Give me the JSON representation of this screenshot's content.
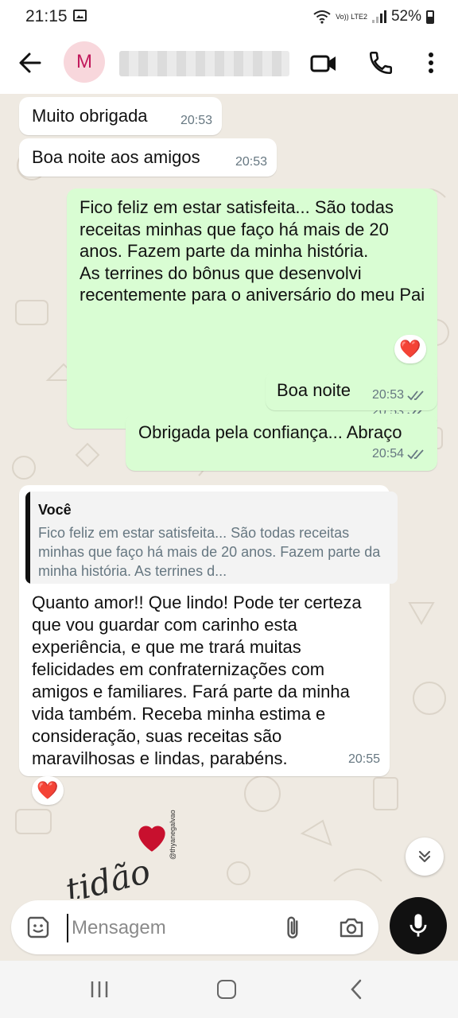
{
  "status_bar": {
    "time": "21:15",
    "network_label": "Vo)) LTE2",
    "battery_percent": "52%"
  },
  "header": {
    "avatar_letter": "M",
    "back_icon": "arrow-left-icon",
    "video_icon": "video-camera-icon",
    "call_icon": "phone-icon",
    "more_icon": "more-vertical-icon"
  },
  "messages": [
    {
      "direction": "in",
      "text": "Muito obrigada",
      "time": "20:53"
    },
    {
      "direction": "in",
      "text": "Boa noite aos amigos",
      "time": "20:53"
    },
    {
      "direction": "out",
      "text": "Fico feliz em estar satisfeita... São todas receitas minhas que faço há mais de 20 anos. Fazem parte da minha história.\nAs terrines do bônus que desenvolvi recentemente para o aniversário do meu Pai",
      "time": "20:53",
      "reaction": "❤️"
    },
    {
      "direction": "out",
      "text": "Boa noite",
      "time": "20:53"
    },
    {
      "direction": "out",
      "text": "Obrigada pela confiança... Abraço",
      "time": "20:54"
    },
    {
      "direction": "in",
      "quote_author": "Você",
      "quote_text": "Fico feliz em estar satisfeita... São todas receitas minhas que faço há mais de 20 anos. Fazem parte da minha história. As terrines d...",
      "text": "Quanto amor!! Que lindo! Pode ter certeza que vou guardar com carinho esta experiência, e que me trará muitas felicidades em confraternizações com amigos e familiares. Fará parte da minha vida também.  Receba minha estima e consideração,  suas receitas são maravilhosas e lindas, parabéns.",
      "time": "20:55",
      "reaction": "❤️"
    }
  ],
  "sticker": {
    "word": "tidão",
    "handle": "@thyanegalvao"
  },
  "composer": {
    "placeholder": "Mensagem",
    "emoji_icon": "sticker-icon",
    "attach_icon": "paperclip-icon",
    "camera_icon": "camera-icon",
    "mic_icon": "mic-icon"
  },
  "colors": {
    "outgoing_bubble": "#d9fdd3",
    "incoming_bubble": "#ffffff",
    "chat_background": "#efeae2",
    "reaction_heart": "#e0245e"
  }
}
